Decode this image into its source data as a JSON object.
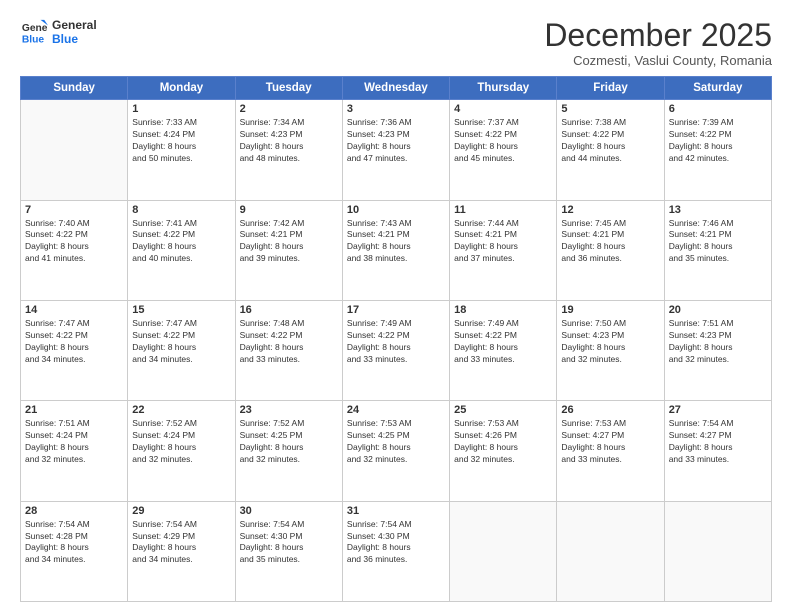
{
  "header": {
    "logo": {
      "line1": "General",
      "line2": "Blue"
    },
    "title": "December 2025",
    "subtitle": "Cozmesti, Vaslui County, Romania"
  },
  "calendar": {
    "days_of_week": [
      "Sunday",
      "Monday",
      "Tuesday",
      "Wednesday",
      "Thursday",
      "Friday",
      "Saturday"
    ],
    "weeks": [
      [
        {
          "day": "",
          "info": ""
        },
        {
          "day": "1",
          "info": "Sunrise: 7:33 AM\nSunset: 4:24 PM\nDaylight: 8 hours\nand 50 minutes."
        },
        {
          "day": "2",
          "info": "Sunrise: 7:34 AM\nSunset: 4:23 PM\nDaylight: 8 hours\nand 48 minutes."
        },
        {
          "day": "3",
          "info": "Sunrise: 7:36 AM\nSunset: 4:23 PM\nDaylight: 8 hours\nand 47 minutes."
        },
        {
          "day": "4",
          "info": "Sunrise: 7:37 AM\nSunset: 4:22 PM\nDaylight: 8 hours\nand 45 minutes."
        },
        {
          "day": "5",
          "info": "Sunrise: 7:38 AM\nSunset: 4:22 PM\nDaylight: 8 hours\nand 44 minutes."
        },
        {
          "day": "6",
          "info": "Sunrise: 7:39 AM\nSunset: 4:22 PM\nDaylight: 8 hours\nand 42 minutes."
        }
      ],
      [
        {
          "day": "7",
          "info": "Sunrise: 7:40 AM\nSunset: 4:22 PM\nDaylight: 8 hours\nand 41 minutes."
        },
        {
          "day": "8",
          "info": "Sunrise: 7:41 AM\nSunset: 4:22 PM\nDaylight: 8 hours\nand 40 minutes."
        },
        {
          "day": "9",
          "info": "Sunrise: 7:42 AM\nSunset: 4:21 PM\nDaylight: 8 hours\nand 39 minutes."
        },
        {
          "day": "10",
          "info": "Sunrise: 7:43 AM\nSunset: 4:21 PM\nDaylight: 8 hours\nand 38 minutes."
        },
        {
          "day": "11",
          "info": "Sunrise: 7:44 AM\nSunset: 4:21 PM\nDaylight: 8 hours\nand 37 minutes."
        },
        {
          "day": "12",
          "info": "Sunrise: 7:45 AM\nSunset: 4:21 PM\nDaylight: 8 hours\nand 36 minutes."
        },
        {
          "day": "13",
          "info": "Sunrise: 7:46 AM\nSunset: 4:21 PM\nDaylight: 8 hours\nand 35 minutes."
        }
      ],
      [
        {
          "day": "14",
          "info": "Sunrise: 7:47 AM\nSunset: 4:22 PM\nDaylight: 8 hours\nand 34 minutes."
        },
        {
          "day": "15",
          "info": "Sunrise: 7:47 AM\nSunset: 4:22 PM\nDaylight: 8 hours\nand 34 minutes."
        },
        {
          "day": "16",
          "info": "Sunrise: 7:48 AM\nSunset: 4:22 PM\nDaylight: 8 hours\nand 33 minutes."
        },
        {
          "day": "17",
          "info": "Sunrise: 7:49 AM\nSunset: 4:22 PM\nDaylight: 8 hours\nand 33 minutes."
        },
        {
          "day": "18",
          "info": "Sunrise: 7:49 AM\nSunset: 4:22 PM\nDaylight: 8 hours\nand 33 minutes."
        },
        {
          "day": "19",
          "info": "Sunrise: 7:50 AM\nSunset: 4:23 PM\nDaylight: 8 hours\nand 32 minutes."
        },
        {
          "day": "20",
          "info": "Sunrise: 7:51 AM\nSunset: 4:23 PM\nDaylight: 8 hours\nand 32 minutes."
        }
      ],
      [
        {
          "day": "21",
          "info": "Sunrise: 7:51 AM\nSunset: 4:24 PM\nDaylight: 8 hours\nand 32 minutes."
        },
        {
          "day": "22",
          "info": "Sunrise: 7:52 AM\nSunset: 4:24 PM\nDaylight: 8 hours\nand 32 minutes."
        },
        {
          "day": "23",
          "info": "Sunrise: 7:52 AM\nSunset: 4:25 PM\nDaylight: 8 hours\nand 32 minutes."
        },
        {
          "day": "24",
          "info": "Sunrise: 7:53 AM\nSunset: 4:25 PM\nDaylight: 8 hours\nand 32 minutes."
        },
        {
          "day": "25",
          "info": "Sunrise: 7:53 AM\nSunset: 4:26 PM\nDaylight: 8 hours\nand 32 minutes."
        },
        {
          "day": "26",
          "info": "Sunrise: 7:53 AM\nSunset: 4:27 PM\nDaylight: 8 hours\nand 33 minutes."
        },
        {
          "day": "27",
          "info": "Sunrise: 7:54 AM\nSunset: 4:27 PM\nDaylight: 8 hours\nand 33 minutes."
        }
      ],
      [
        {
          "day": "28",
          "info": "Sunrise: 7:54 AM\nSunset: 4:28 PM\nDaylight: 8 hours\nand 34 minutes."
        },
        {
          "day": "29",
          "info": "Sunrise: 7:54 AM\nSunset: 4:29 PM\nDaylight: 8 hours\nand 34 minutes."
        },
        {
          "day": "30",
          "info": "Sunrise: 7:54 AM\nSunset: 4:30 PM\nDaylight: 8 hours\nand 35 minutes."
        },
        {
          "day": "31",
          "info": "Sunrise: 7:54 AM\nSunset: 4:30 PM\nDaylight: 8 hours\nand 36 minutes."
        },
        {
          "day": "",
          "info": ""
        },
        {
          "day": "",
          "info": ""
        },
        {
          "day": "",
          "info": ""
        }
      ]
    ]
  }
}
